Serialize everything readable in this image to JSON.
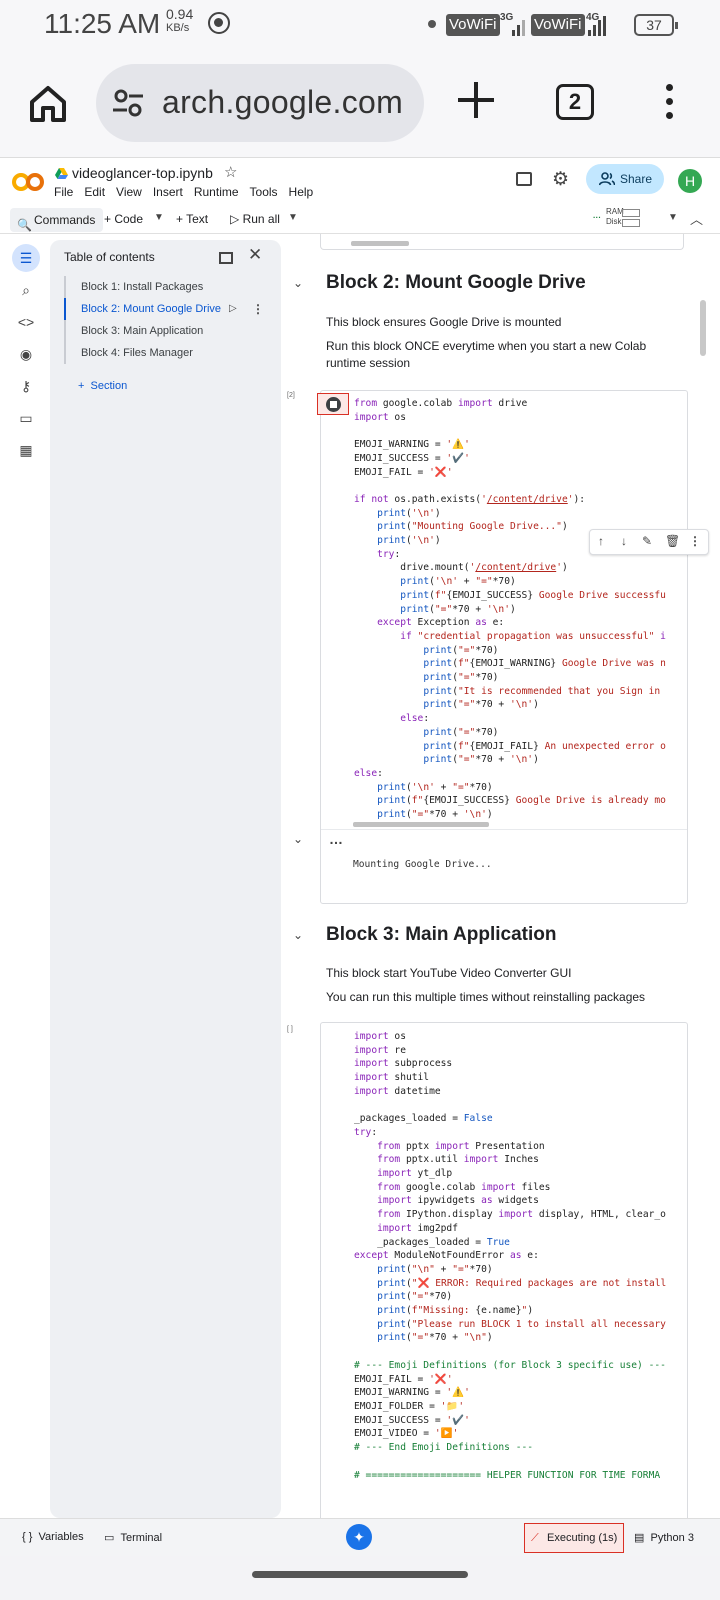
{
  "status_bar": {
    "time": "11:25 AM",
    "net_speed": "0.94",
    "net_unit": "KB/s",
    "vowifi_1": "VoWiFi",
    "sig_1": "3G",
    "vowifi_2": "VoWiFi",
    "sig_2": "4G",
    "battery": "37"
  },
  "browser": {
    "url": "arch.google.com",
    "tab_count": "2"
  },
  "colab": {
    "notebook_name": "videoglancer-top.ipynb",
    "menus": [
      "File",
      "Edit",
      "View",
      "Insert",
      "Runtime",
      "Tools",
      "Help"
    ],
    "share_label": "Share",
    "avatar_letter": "H",
    "toolbar": {
      "commands": "Commands",
      "code": "Code",
      "text": "Text",
      "run_all": "Run all",
      "ram": "RAM",
      "disk": "Disk"
    }
  },
  "toc": {
    "title": "Table of contents",
    "items": [
      "Block 1: Install Packages",
      "Block 2: Mount Google Drive",
      "Block 3: Main Application",
      "Block 4: Files Manager"
    ],
    "active_index": 1,
    "add_section": "Section"
  },
  "block2": {
    "heading": "Block 2: Mount Google Drive",
    "para1": "This block ensures Google Drive is mounted",
    "para2": "Run this block ONCE everytime when you start a new Colab runtime session",
    "exec_count": "[2]",
    "output": "Mounting Google Drive..."
  },
  "block3": {
    "heading": "Block 3: Main Application",
    "para1": "This block start YouTube Video Converter GUI",
    "para2": "You can run this multiple times without reinstalling packages",
    "exec_count": "[ ]"
  },
  "bottom": {
    "variables": "Variables",
    "terminal": "Terminal",
    "executing": "Executing (1s)",
    "runtime": "Python 3"
  }
}
